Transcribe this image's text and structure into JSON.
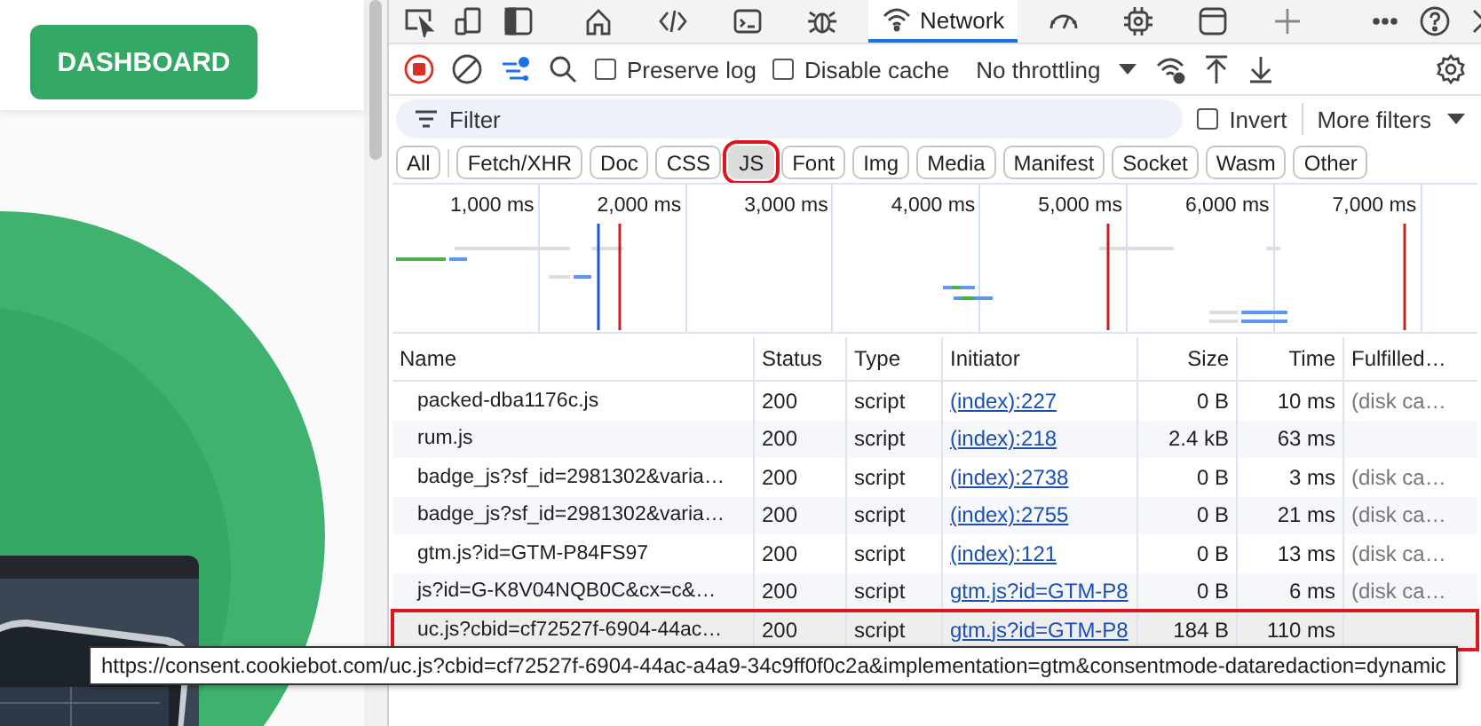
{
  "page": {
    "button": "DASHBOARD"
  },
  "devtools": {
    "tabs": [
      {
        "selected": false
      },
      {
        "selected": false
      },
      {
        "selected": false
      },
      {
        "selected": false
      },
      {
        "label": "Network",
        "selected": true
      },
      {
        "selected": false
      },
      {
        "selected": false
      },
      {
        "selected": false
      }
    ],
    "toolbar": {
      "recording": true,
      "preserve_log": {
        "label": "Preserve log",
        "checked": false
      },
      "disable_cache": {
        "label": "Disable cache",
        "checked": false
      },
      "throttling": "No throttling"
    },
    "filter": {
      "placeholder": "Filter",
      "invert": {
        "label": "Invert",
        "checked": false
      },
      "more_filters": "More filters"
    },
    "chips": [
      {
        "label": "All",
        "selected": false,
        "annotated": false
      },
      {
        "label": "Fetch/XHR",
        "selected": false,
        "annotated": false
      },
      {
        "label": "Doc",
        "selected": false,
        "annotated": false
      },
      {
        "label": "CSS",
        "selected": false,
        "annotated": false
      },
      {
        "label": "JS",
        "selected": true,
        "annotated": true
      },
      {
        "label": "Font",
        "selected": false,
        "annotated": false
      },
      {
        "label": "Img",
        "selected": false,
        "annotated": false
      },
      {
        "label": "Media",
        "selected": false,
        "annotated": false
      },
      {
        "label": "Manifest",
        "selected": false,
        "annotated": false
      },
      {
        "label": "Socket",
        "selected": false,
        "annotated": false
      },
      {
        "label": "Wasm",
        "selected": false,
        "annotated": false
      },
      {
        "label": "Other",
        "selected": false,
        "annotated": false
      }
    ],
    "overview_ticks": [
      "1,000 ms",
      "2,000 ms",
      "3,000 ms",
      "4,000 ms",
      "5,000 ms",
      "6,000 ms",
      "7,000 ms"
    ],
    "table": {
      "columns": [
        "Name",
        "Status",
        "Type",
        "Initiator",
        "Size",
        "Time",
        "Fulfilled…"
      ],
      "rows": [
        {
          "name": "packed-dba1176c.js",
          "status": "200",
          "type": "script",
          "initiator": "(index):227",
          "size": "0 B",
          "time": "10 ms",
          "fulfilled": "(disk ca…",
          "selected": false,
          "annotated": false
        },
        {
          "name": "rum.js",
          "status": "200",
          "type": "script",
          "initiator": "(index):218",
          "size": "2.4 kB",
          "time": "63 ms",
          "selected": false,
          "annotated": false
        },
        {
          "name": "badge_js?sf_id=2981302&varia…",
          "status": "200",
          "type": "script",
          "initiator": "(index):2738",
          "size": "0 B",
          "time": "3 ms",
          "fulfilled": "(disk ca…",
          "selected": false,
          "annotated": false
        },
        {
          "name": "badge_js?sf_id=2981302&varia…",
          "status": "200",
          "type": "script",
          "initiator": "(index):2755",
          "size": "0 B",
          "time": "21 ms",
          "fulfilled": "(disk ca…",
          "selected": false,
          "annotated": false
        },
        {
          "name": "gtm.js?id=GTM-P84FS97",
          "status": "200",
          "type": "script",
          "initiator": "(index):121",
          "size": "0 B",
          "time": "13 ms",
          "fulfilled": "(disk ca…",
          "selected": false,
          "annotated": false
        },
        {
          "name": "js?id=G-K8V04NQB0C&cx=c&…",
          "status": "200",
          "type": "script",
          "initiator": "gtm.js?id=GTM-P8",
          "size": "0 B",
          "time": "6 ms",
          "fulfilled": "(disk ca…",
          "selected": false,
          "annotated": false
        },
        {
          "name": "uc.js?cbid=cf72527f-6904-44ac…",
          "status": "200",
          "type": "script",
          "initiator": "gtm.js?id=GTM-P8",
          "size": "184 B",
          "time": "110 ms",
          "selected": true,
          "annotated": true
        }
      ]
    },
    "tooltip": "https://consent.cookiebot.com/uc.js?cbid=cf72527f-6904-44ac-a4a9-34c9ff0f0c2a&implementation=gtm&consentmode-dataredaction=dynamic"
  }
}
